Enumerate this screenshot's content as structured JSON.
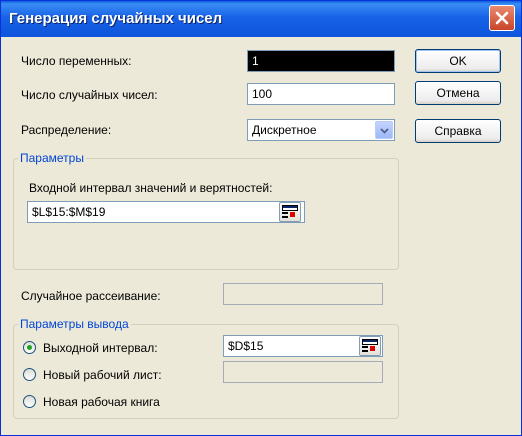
{
  "window": {
    "title": "Генерация случайных чисел"
  },
  "fields": {
    "num_vars_label": "Число переменных:",
    "num_vars_value": "1",
    "num_random_label": "Число случайных чисел:",
    "num_random_value": "100",
    "distribution_label": "Распределение:",
    "distribution_value": "Дискретное"
  },
  "buttons": {
    "ok": "OK",
    "cancel": "Отмена",
    "help": "Справка"
  },
  "params": {
    "legend": "Параметры",
    "range_label": "Входной интервал значений и верятностей:",
    "range_value": "$L$15:$M$19"
  },
  "seed": {
    "label": "Случайное рассеивание:",
    "value": ""
  },
  "output": {
    "legend": "Параметры вывода",
    "output_range_label": "Выходной интервал:",
    "output_range_value": "$D$15",
    "new_sheet_label": "Новый рабочий лист:",
    "new_sheet_value": "",
    "new_book_label": "Новая рабочая книга",
    "selected": "output_range"
  },
  "icons": {
    "close": "close-icon",
    "ref": "range-picker-icon",
    "dropdown": "chevron-down-icon"
  }
}
